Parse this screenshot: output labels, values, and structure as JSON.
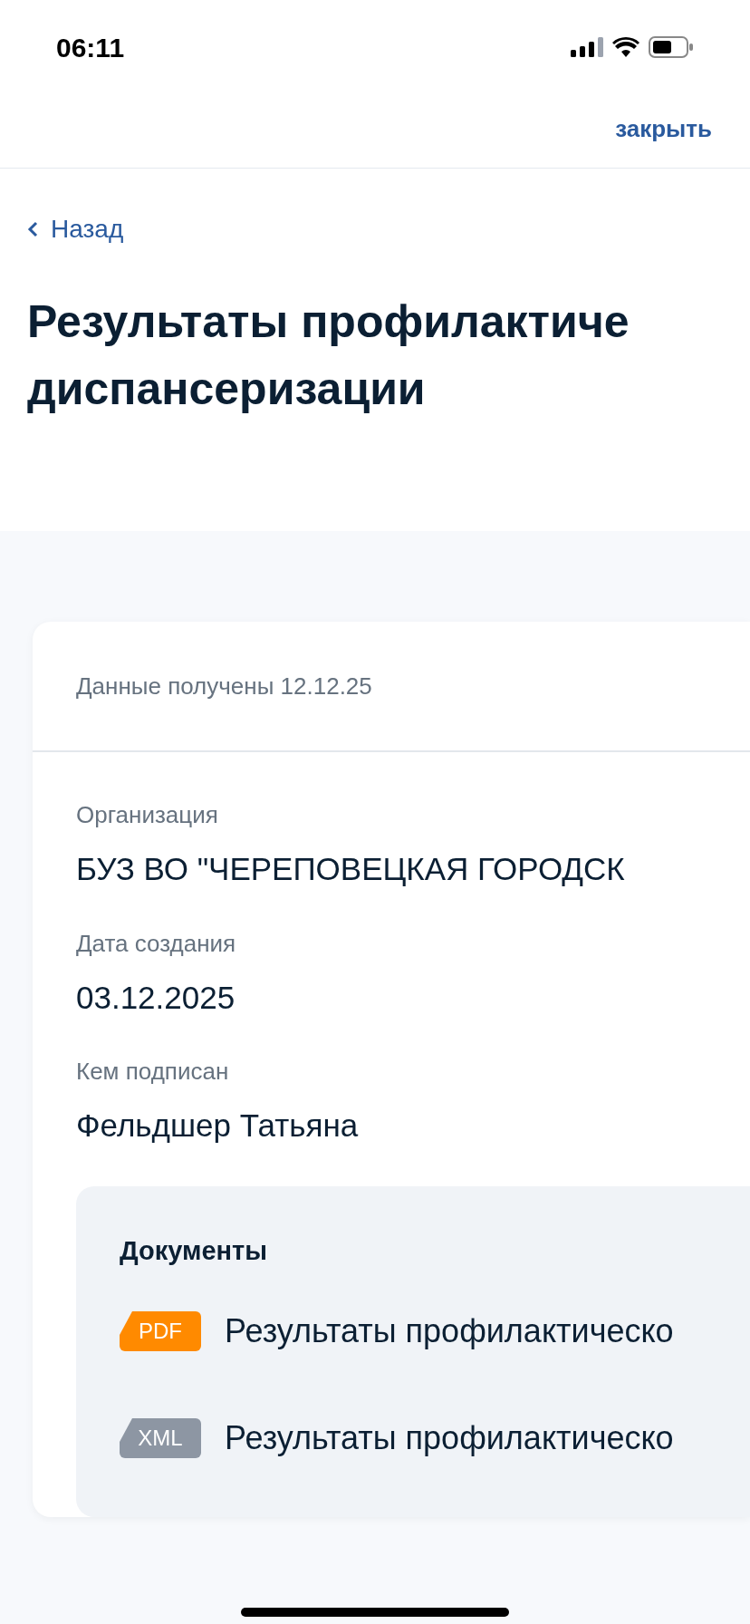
{
  "status_bar": {
    "time": "06:11"
  },
  "header": {
    "close": "закрыть"
  },
  "back": {
    "label": "Назад"
  },
  "title": [
    "Результаты профилактиче",
    "диспансеризации"
  ],
  "card": {
    "received": "Данные получены 12.12.25",
    "fields": [
      {
        "label": "Организация",
        "value": "БУЗ ВО \"ЧЕРЕПОВЕЦКАЯ ГОРОДСК"
      },
      {
        "label": "Дата создания",
        "value": "03.12.2025"
      },
      {
        "label": "Кем подписан",
        "value": "Фельдшер Татьяна"
      }
    ],
    "documents": {
      "title": "Документы",
      "items": [
        {
          "kind": "pdf",
          "badge": "PDF",
          "name": "Результаты профилактическо"
        },
        {
          "kind": "xml",
          "badge": "XML",
          "name": "Результаты профилактическо"
        }
      ]
    }
  }
}
